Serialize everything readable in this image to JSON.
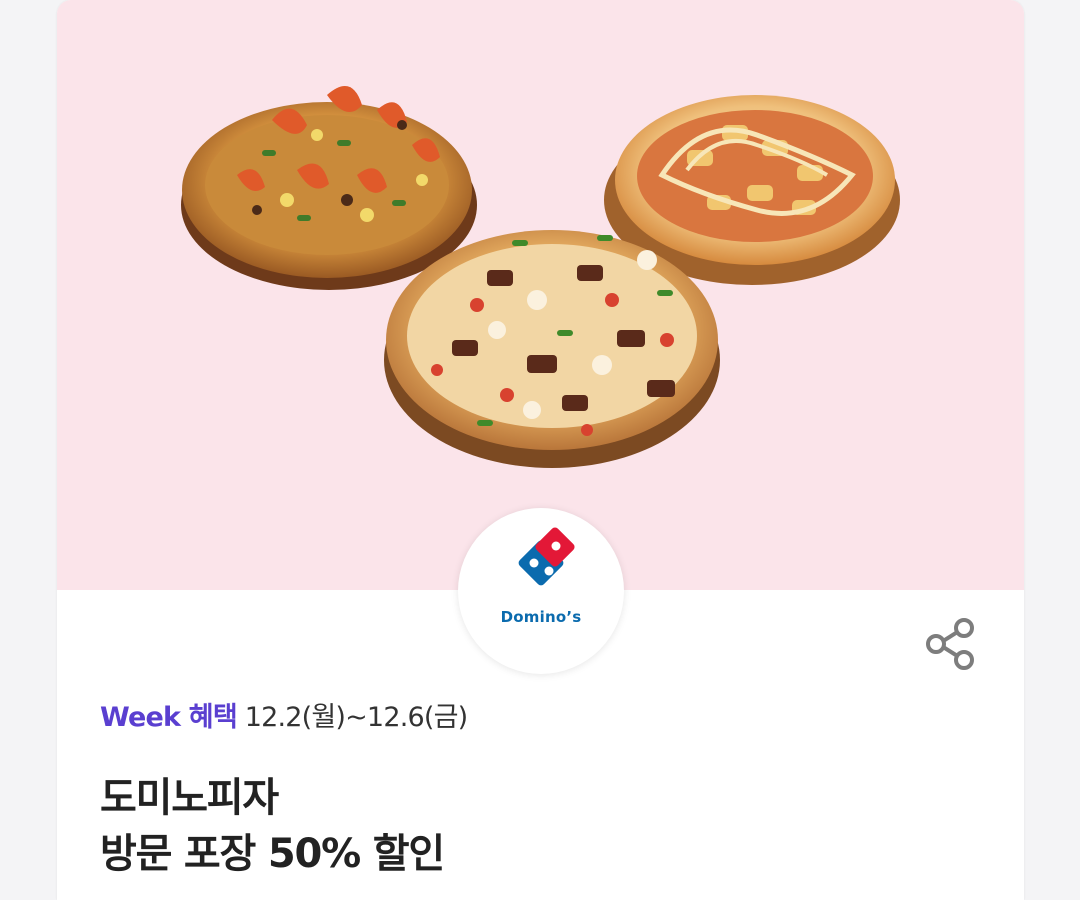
{
  "banner": {
    "background_color": "#fbe4ea",
    "images": [
      "shrimp-pizza-image",
      "supreme-pizza-image",
      "potato-pizza-image"
    ]
  },
  "brand": {
    "logo_text": "Domino’s",
    "logo_colors": {
      "blue": "#0b6bae",
      "red": "#e31837"
    }
  },
  "actions": {
    "share_icon": "share-icon"
  },
  "promo": {
    "week_tag": "Week 혜택",
    "period": "12.2(월)~12.6(금)",
    "title_line1": "도미노피자",
    "title_line2": "방문 포장 50% 할인"
  },
  "colors": {
    "accent": "#5a3fd0",
    "text": "#222222"
  }
}
